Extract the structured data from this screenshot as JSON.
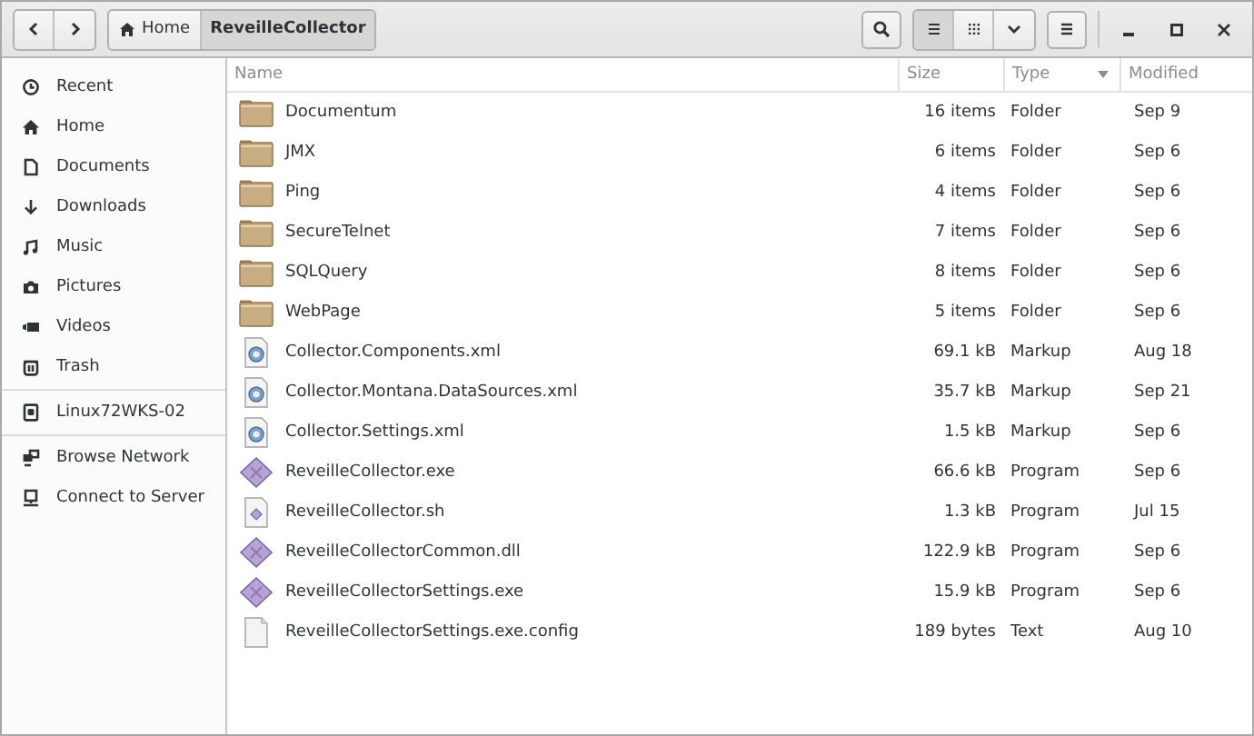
{
  "breadcrumb": [
    {
      "label": "Home",
      "selected": false
    },
    {
      "label": "ReveilleCollector",
      "selected": true
    }
  ],
  "view_buttons": [
    {
      "kind": "list",
      "selected": true
    },
    {
      "kind": "grid",
      "selected": false
    }
  ],
  "sidebar": {
    "sections": [
      {
        "items": [
          {
            "label": "Recent"
          },
          {
            "label": "Home"
          },
          {
            "label": "Documents"
          },
          {
            "label": "Downloads"
          },
          {
            "label": "Music"
          },
          {
            "label": "Pictures"
          },
          {
            "label": "Videos"
          },
          {
            "label": "Trash"
          }
        ]
      },
      {
        "items": [
          {
            "label": "Linux72WKS-02"
          }
        ]
      },
      {
        "items": [
          {
            "label": "Browse Network"
          },
          {
            "label": "Connect to Server"
          }
        ]
      }
    ]
  },
  "table": {
    "columns": [
      {
        "label": "Name",
        "sorted": false
      },
      {
        "label": "Size",
        "sorted": false
      },
      {
        "label": "Type",
        "sorted": true
      },
      {
        "label": "Modified",
        "sorted": false
      }
    ],
    "rows": [
      {
        "kind": "folder",
        "name": "Documentum",
        "size": "16 items",
        "type": "Folder",
        "modified": "Sep 9"
      },
      {
        "kind": "folder",
        "name": "JMX",
        "size": "6 items",
        "type": "Folder",
        "modified": "Sep 6"
      },
      {
        "kind": "folder",
        "name": "Ping",
        "size": "4 items",
        "type": "Folder",
        "modified": "Sep 6"
      },
      {
        "kind": "folder",
        "name": "SecureTelnet",
        "size": "7 items",
        "type": "Folder",
        "modified": "Sep 6"
      },
      {
        "kind": "folder",
        "name": "SQLQuery",
        "size": "8 items",
        "type": "Folder",
        "modified": "Sep 6"
      },
      {
        "kind": "folder",
        "name": "WebPage",
        "size": "5 items",
        "type": "Folder",
        "modified": "Sep 6"
      },
      {
        "kind": "markup",
        "name": "Collector.Components.xml",
        "size": "69.1 kB",
        "type": "Markup",
        "modified": "Aug 18"
      },
      {
        "kind": "markup",
        "name": "Collector.Montana.DataSources.xml",
        "size": "35.7 kB",
        "type": "Markup",
        "modified": "Sep 21"
      },
      {
        "kind": "markup",
        "name": "Collector.Settings.xml",
        "size": "1.5 kB",
        "type": "Markup",
        "modified": "Sep 6"
      },
      {
        "kind": "program",
        "name": "ReveilleCollector.exe",
        "size": "66.6 kB",
        "type": "Program",
        "modified": "Sep 6"
      },
      {
        "kind": "script",
        "name": "ReveilleCollector.sh",
        "size": "1.3 kB",
        "type": "Program",
        "modified": "Jul 15"
      },
      {
        "kind": "program",
        "name": "ReveilleCollectorCommon.dll",
        "size": "122.9 kB",
        "type": "Program",
        "modified": "Sep 6"
      },
      {
        "kind": "program",
        "name": "ReveilleCollectorSettings.exe",
        "size": "15.9 kB",
        "type": "Program",
        "modified": "Sep 6"
      },
      {
        "kind": "text",
        "name": "ReveilleCollectorSettings.exe.config",
        "size": "189 bytes",
        "type": "Text",
        "modified": "Aug 10"
      }
    ]
  }
}
